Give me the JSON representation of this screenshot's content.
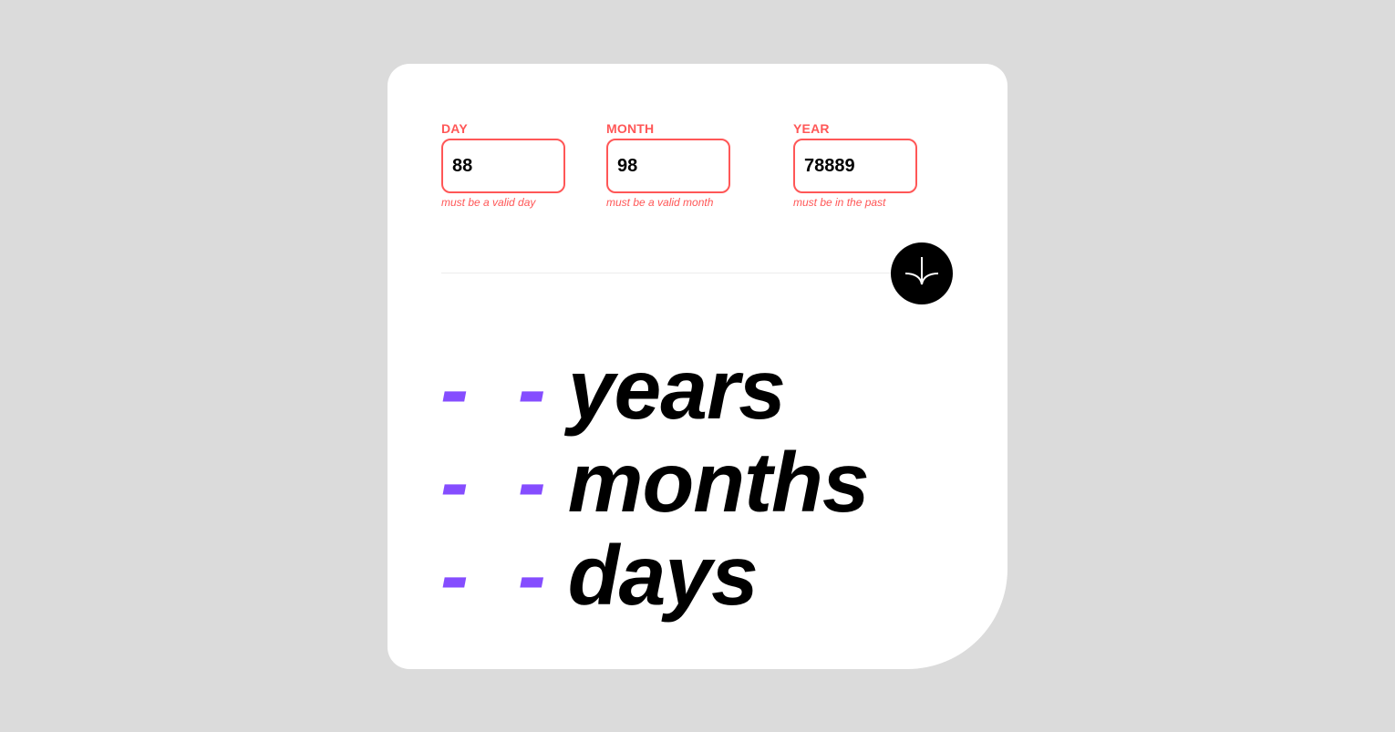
{
  "form": {
    "day": {
      "label": "DAY",
      "value": "88",
      "error": "must be a valid day"
    },
    "month": {
      "label": "MONTH",
      "value": "98",
      "error": "must be a valid month"
    },
    "year": {
      "label": "YEAR",
      "value": "78889",
      "error": "must be in the past"
    },
    "submit_icon": "arrow-down-icon"
  },
  "results": {
    "years": {
      "value": "- -",
      "unit": "years"
    },
    "months": {
      "value": "- -",
      "unit": "months"
    },
    "days": {
      "value": "- -",
      "unit": "days"
    }
  },
  "colors": {
    "accent": "#854dff",
    "error": "#ff5757",
    "background": "#dbdbdb",
    "card": "#ffffff",
    "text": "#000000"
  }
}
